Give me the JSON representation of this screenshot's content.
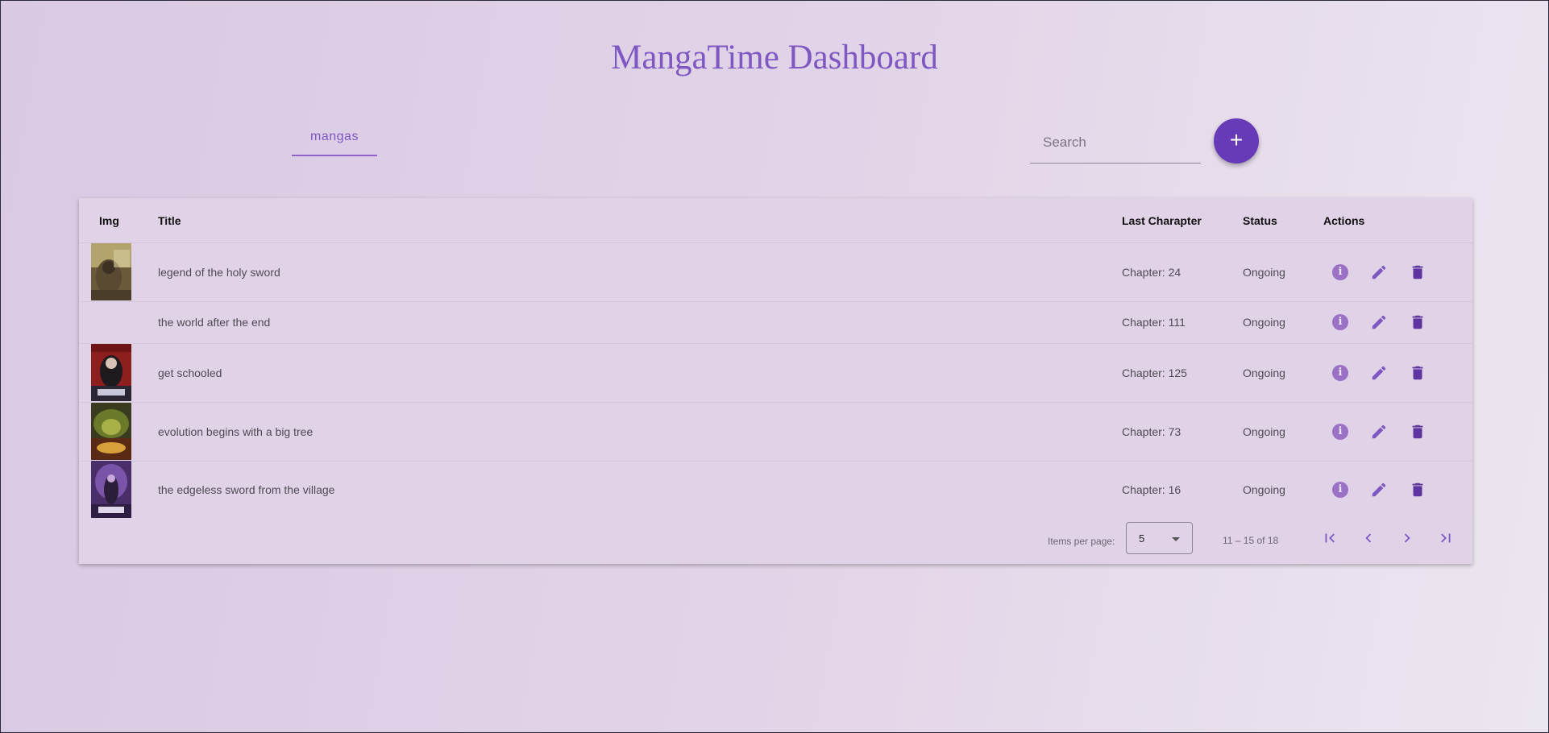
{
  "app": {
    "title": "MangaTime Dashboard"
  },
  "tabs": [
    {
      "label": "mangas"
    }
  ],
  "search": {
    "placeholder": "Search",
    "value": ""
  },
  "add_button": {
    "label": "+"
  },
  "table": {
    "columns": {
      "img": "Img",
      "title": "Title",
      "last_chapter": "Last Charapter",
      "status": "Status",
      "actions": "Actions"
    },
    "rows": [
      {
        "title": "legend of the holy sword",
        "chapter": "Chapter: 24",
        "status": "Ongoing",
        "has_image": true
      },
      {
        "title": "the world after the end",
        "chapter": "Chapter: 111",
        "status": "Ongoing",
        "has_image": false
      },
      {
        "title": "get schooled",
        "chapter": "Chapter: 125",
        "status": "Ongoing",
        "has_image": true
      },
      {
        "title": "evolution begins with a big tree",
        "chapter": "Chapter: 73",
        "status": "Ongoing",
        "has_image": true
      },
      {
        "title": "the edgeless sword from the village",
        "chapter": "Chapter: 16",
        "status": "Ongoing",
        "has_image": true
      }
    ]
  },
  "paginator": {
    "items_per_page_label": "Items per page:",
    "items_per_page": "5",
    "range_label": "11 – 15 of 18"
  },
  "colors": {
    "accent": "#7e57c2",
    "fab": "#673ab7",
    "icon": "#7e57c2",
    "delete": "#5e35a0"
  },
  "icons": {
    "info": "info-icon",
    "edit": "pencil-icon",
    "delete": "trash-icon",
    "first": "first-page-icon",
    "prev": "chevron-left-icon",
    "next": "chevron-right-icon",
    "last": "last-page-icon"
  }
}
